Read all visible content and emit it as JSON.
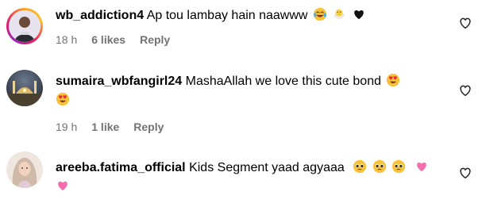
{
  "comments": [
    {
      "username": "wb_addiction4",
      "text": "Ap tou lambay hain naawww",
      "emojis": [
        "face-with-tears-of-joy",
        "hatching-chick",
        "black-heart"
      ],
      "time": "18 h",
      "likes": "6 likes",
      "reply": "Reply",
      "avatar": "portrait-with-story-ring"
    },
    {
      "username": "sumaira_wbfangirl24",
      "text": "MashaAllah we love this cute bond",
      "emojis": [
        "smiling-face-with-heart-eyes",
        "smiling-face-with-heart-eyes"
      ],
      "time": "19 h",
      "likes": "1 like",
      "reply": "Reply",
      "avatar": "night-mosque-photo"
    },
    {
      "username": "areeba.fatima_official",
      "text": "Kids Segment yaad agyaaa",
      "emojis": [
        "pleading-face",
        "pleading-face",
        "pleading-face",
        "pink-heart",
        "pink-heart"
      ],
      "avatar": "portrait-with-headscarf"
    }
  ],
  "icons": {
    "like": "heart-outline-icon"
  },
  "colors": {
    "meta": "#737373",
    "text": "#000000",
    "background": "#ffffff"
  }
}
